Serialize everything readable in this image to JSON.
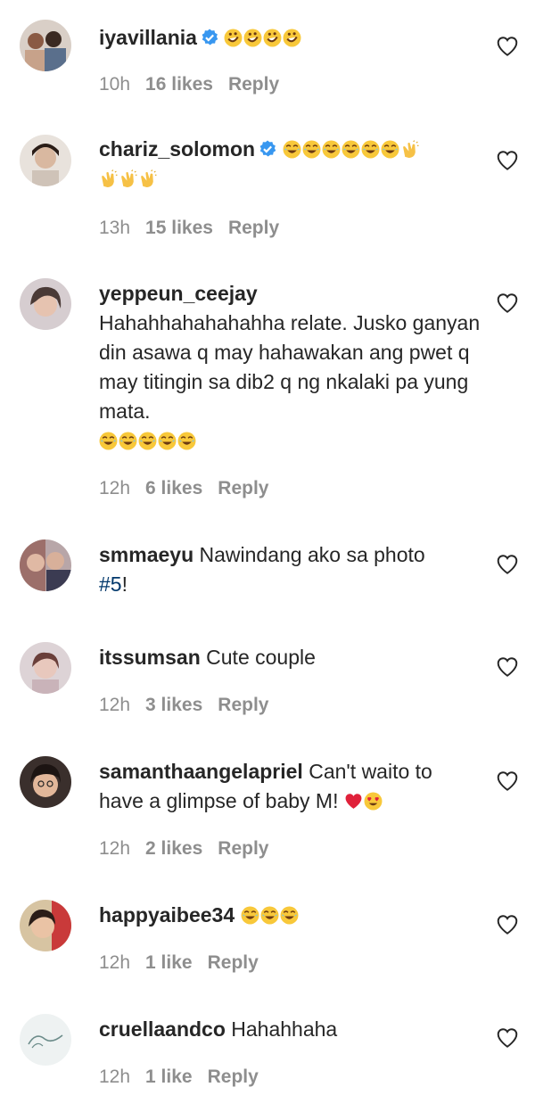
{
  "comments": [
    {
      "username": "iyavillania",
      "verified": true,
      "text": "",
      "emojis": [
        "rofl-emoji",
        "rofl-emoji",
        "rofl-emoji",
        "rofl-emoji"
      ],
      "time": "10h",
      "likes": "16 likes",
      "reply": "Reply"
    },
    {
      "username": "chariz_solomon",
      "verified": true,
      "text": "",
      "emojis": [
        "joy-emoji",
        "joy-emoji",
        "joy-emoji",
        "joy-emoji",
        "joy-emoji",
        "joy-emoji",
        "clap-emoji",
        "clap-emoji",
        "clap-emoji",
        "clap-emoji"
      ],
      "time": "13h",
      "likes": "15 likes",
      "reply": "Reply"
    },
    {
      "username": "yeppeun_ceejay",
      "verified": false,
      "text": "Hahahhahahahahha relate. Jusko ganyan din asawa q may hahawakan ang pwet q may titingin sa dib2 q ng nkalaki pa yung mata.",
      "emojis": [
        "joy-emoji",
        "joy-emoji",
        "joy-emoji",
        "joy-emoji",
        "joy-emoji"
      ],
      "time": "12h",
      "likes": "6 likes",
      "reply": "Reply"
    },
    {
      "username": "smmaeyu",
      "verified": false,
      "text": "Nawindang ako sa photo",
      "hashtag": "#5",
      "text_after": "!",
      "emojis": [],
      "time": "",
      "likes": "",
      "reply": ""
    },
    {
      "username": "itssumsan",
      "verified": false,
      "text": "Cute couple",
      "emojis": [],
      "time": "12h",
      "likes": "3 likes",
      "reply": "Reply"
    },
    {
      "username": "samanthaangelapriel",
      "verified": false,
      "text": "Can't waito to have a glimpse of baby M!",
      "emojis": [
        "heart-emoji",
        "heart-eyes-emoji"
      ],
      "time": "12h",
      "likes": "2 likes",
      "reply": "Reply"
    },
    {
      "username": "happyaibee34",
      "verified": false,
      "text": "",
      "emojis": [
        "joy-emoji",
        "joy-emoji",
        "joy-emoji"
      ],
      "time": "12h",
      "likes": "1 like",
      "reply": "Reply"
    },
    {
      "username": "cruellaandco",
      "verified": false,
      "text": "Hahahhaha",
      "emojis": [],
      "time": "12h",
      "likes": "1 like",
      "reply": "Reply"
    }
  ],
  "colors": {
    "text": "#262626",
    "meta": "#8e8e8e",
    "verified": "#3897f0",
    "hashtag": "#00376b"
  }
}
